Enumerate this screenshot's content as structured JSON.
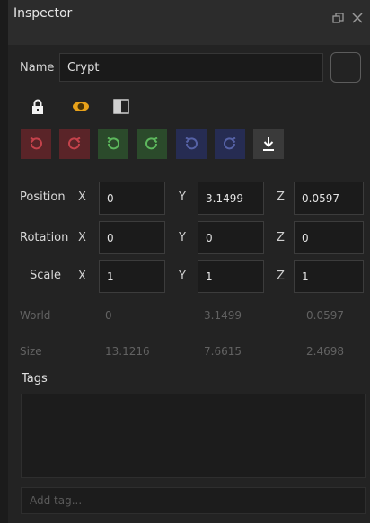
{
  "window": {
    "title": "Inspector",
    "restore_icon": "restore-window-icon",
    "close_icon": "close-icon"
  },
  "name": {
    "label": "Name",
    "value": "Crypt",
    "color_swatch_color": "#232323"
  },
  "toggles": [
    {
      "icon": "lock-icon",
      "color": "#f2f2f2"
    },
    {
      "icon": "eye-icon",
      "color": "#e8a21a"
    },
    {
      "icon": "half-fill-icon",
      "color": "#d0d0d0"
    }
  ],
  "toolbar": [
    {
      "icon": "undo-icon",
      "color": "#c4424b"
    },
    {
      "icon": "redo-icon",
      "color": "#c4424b"
    },
    {
      "icon": "undo-icon",
      "color": "#5db85d"
    },
    {
      "icon": "redo-icon",
      "color": "#5db85d"
    },
    {
      "icon": "undo-icon",
      "color": "#5662a6"
    },
    {
      "icon": "redo-icon",
      "color": "#5662a6"
    },
    {
      "icon": "download-icon",
      "color": "#ffffff"
    }
  ],
  "transform": {
    "position": {
      "label": "Position",
      "x_label": "X",
      "y_label": "Y",
      "z_label": "Z",
      "x": "0",
      "y": "3.1499",
      "z": "0.0597"
    },
    "rotation": {
      "label": "Rotation",
      "x_label": "X",
      "y_label": "Y",
      "z_label": "Z",
      "x": "0",
      "y": "0",
      "z": "0"
    },
    "scale": {
      "label": "Scale",
      "x_label": "X",
      "y_label": "Y",
      "z_label": "Z",
      "x": "1",
      "y": "1",
      "z": "1"
    }
  },
  "world": {
    "label": "World",
    "x": "0",
    "y": "3.1499",
    "z": "0.0597"
  },
  "size": {
    "label": "Size",
    "x": "13.1216",
    "y": "7.6615",
    "z": "2.4698"
  },
  "tags": {
    "label": "Tags",
    "placeholder": "Add tag..."
  }
}
